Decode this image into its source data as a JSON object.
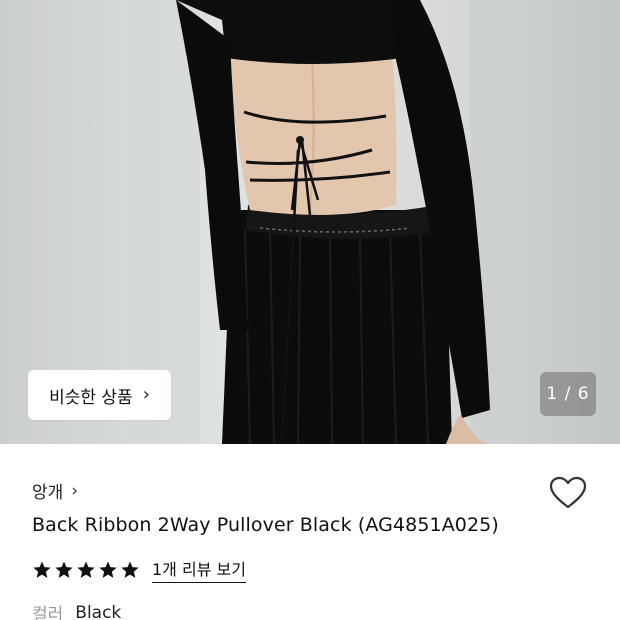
{
  "gallery": {
    "similar_label": "비슷한 상품",
    "similar_chevron": "›",
    "current_page": 1,
    "total_pages": 6,
    "page_text": "1 / 6"
  },
  "product": {
    "brand": "앙개",
    "brand_chevron": "›",
    "title": "Back Ribbon 2Way Pullover Black (AG4851A025)",
    "rating": 5,
    "review_link": "1개 리뷰 보기",
    "color_label": "컬러",
    "color_value": "Black"
  },
  "colors": {
    "star": "#111111",
    "heart_outline": "#333333"
  },
  "icons": {
    "wish": "heart-outline-icon",
    "star": "star-icon"
  }
}
